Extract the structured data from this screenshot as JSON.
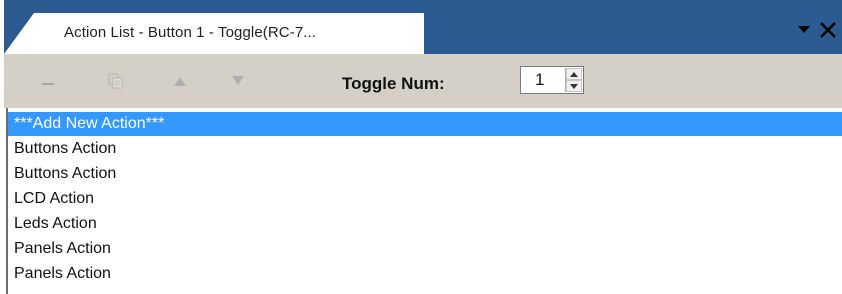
{
  "window": {
    "tab_title": "Action List - Button 1 - Toggle(RC-7...",
    "accent_color": "#2c5b92"
  },
  "title_controls": {
    "dropdown_icon": "triangle-down-icon",
    "close_icon": "close-icon"
  },
  "toolbar": {
    "buttons": [
      {
        "icon": "remove-icon",
        "enabled": false
      },
      {
        "icon": "copy-icon",
        "enabled": false
      },
      {
        "icon": "move-up-icon",
        "enabled": false
      },
      {
        "icon": "move-down-icon",
        "enabled": false
      }
    ],
    "toggle_label": "Toggle Num:",
    "toggle_value": "1"
  },
  "action_list": {
    "selected_color": "#3399ff",
    "items": [
      {
        "label": "***Add New Action***",
        "selected": true
      },
      {
        "label": "Buttons Action",
        "selected": false
      },
      {
        "label": "Buttons Action",
        "selected": false
      },
      {
        "label": "LCD Action",
        "selected": false
      },
      {
        "label": "Leds Action",
        "selected": false
      },
      {
        "label": "Panels Action",
        "selected": false
      },
      {
        "label": "Panels Action",
        "selected": false
      }
    ]
  }
}
